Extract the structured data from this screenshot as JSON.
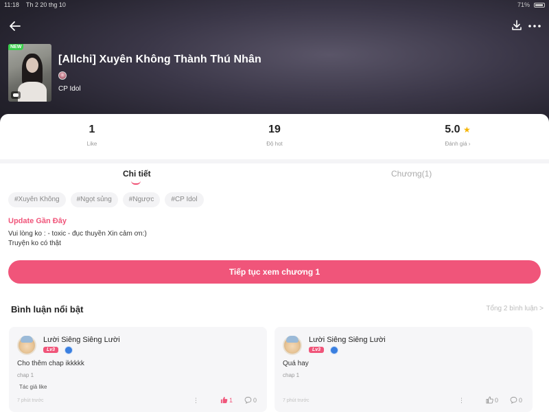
{
  "status_bar": {
    "time": "11:18",
    "date": "Th 2 20 thg 10",
    "battery": "71%"
  },
  "book": {
    "cover_badge": "NEW",
    "title": "[Allchi] Xuyên Không Thành Thú Nhân",
    "author": "CP Idol"
  },
  "stats": {
    "likes": {
      "value": "1",
      "label": "Like"
    },
    "hot": {
      "value": "19",
      "label": "Độ hot"
    },
    "rating": {
      "value": "5.0",
      "label": "Đánh giá",
      "arrow": "›",
      "star": "★"
    }
  },
  "tabs": [
    {
      "label": "Chi tiết",
      "active": true
    },
    {
      "label": "Chương(1)",
      "active": false
    }
  ],
  "tags": [
    "#Xuyên Không",
    "#Ngọt sủng",
    "#Ngược",
    "#CP Idol"
  ],
  "update": {
    "title": "Update Gần Đây",
    "lines": [
      "Vui lòng ko : - toxic - đục thuyền  Xin cảm ơn:)",
      "Truyện ko có thật"
    ]
  },
  "continue_button": "Tiếp tục xem chương 1",
  "comments_section": {
    "title": "Bình luận nổi bật",
    "total": "Tổng 2 bình luận >",
    "comments": [
      {
        "user": "Lười Siêng Siêng Lười",
        "level": "Lv3",
        "text": "Cho thêm chap ikkkkk",
        "chapter": "chap 1",
        "author_liked": "Tác giả like",
        "time": "7 phút trước",
        "likes": "1",
        "liked": true,
        "replies": "0"
      },
      {
        "user": "Lười Siêng Siêng Lười",
        "level": "Lv3",
        "text": "Quá hay",
        "chapter": "chap 1",
        "author_liked": "",
        "time": "7 phút trước",
        "likes": "0",
        "liked": false,
        "replies": "0"
      }
    ]
  },
  "colors": {
    "accent": "#f0557a",
    "star": "#f5b400",
    "new_badge": "#3ccf4e"
  },
  "icons": [
    "back-arrow-icon",
    "download-icon",
    "more-icon",
    "chat-icon",
    "star-icon",
    "medal-icon",
    "thumb-up-icon",
    "comment-icon",
    "menu-dots-icon"
  ]
}
